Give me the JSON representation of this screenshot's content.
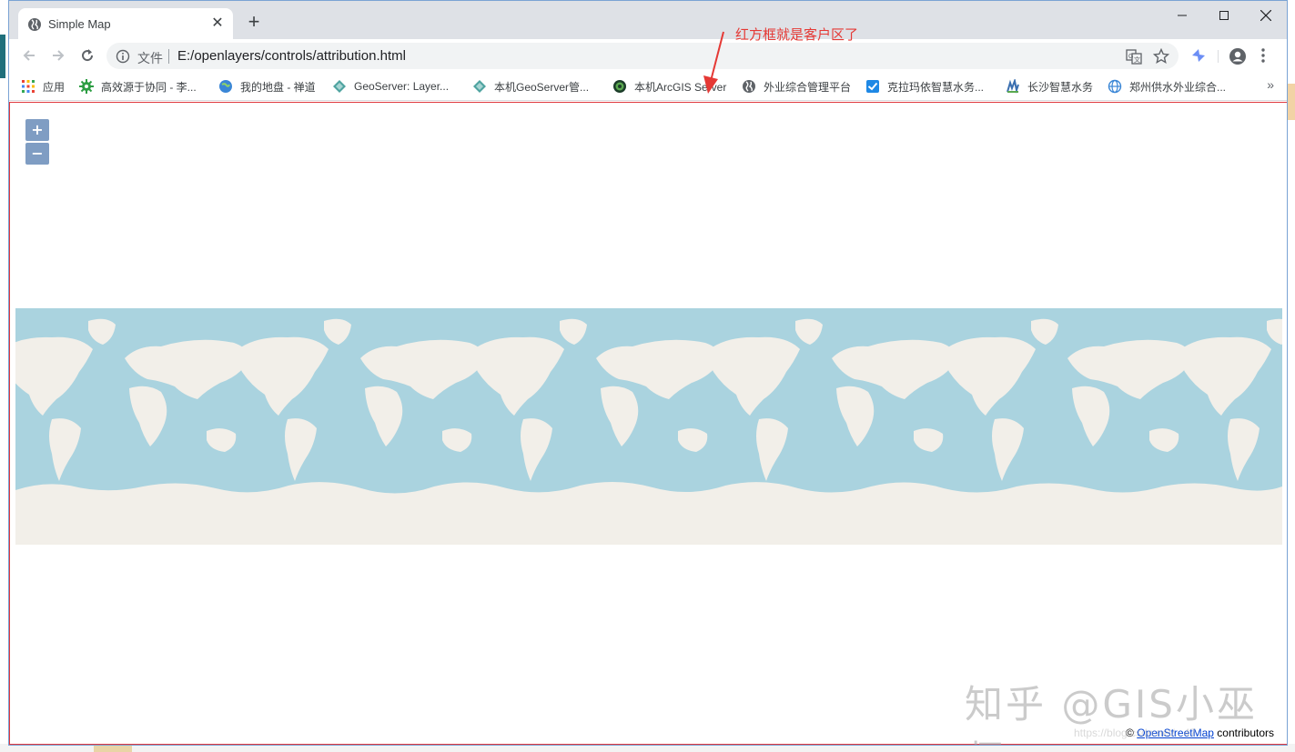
{
  "window": {
    "tab": {
      "title": "Simple Map",
      "favicon": "globe-icon",
      "close_icon": "close-icon"
    },
    "newtab_icon": "plus-icon",
    "controls": {
      "minimize": "minimize-icon",
      "maximize": "maximize-icon",
      "close": "close-icon"
    }
  },
  "toolbar": {
    "back_icon": "arrow-left-icon",
    "forward_icon": "arrow-right-icon",
    "reload_icon": "reload-icon",
    "scheme_label": "文件",
    "url": "E:/openlayers/controls/attribution.html"
  },
  "bookmarks": [
    {
      "label": "应用",
      "icon": "apps-grid-icon"
    },
    {
      "label": "高效源于协同 - 李...",
      "icon": "green-gear-icon"
    },
    {
      "label": "我的地盘 - 禅道",
      "icon": "blue-globe-icon"
    },
    {
      "label": "GeoServer: Layer...",
      "icon": "geoserver-icon"
    },
    {
      "label": "本机GeoServer管...",
      "icon": "geoserver-icon"
    },
    {
      "label": "本机ArcGIS Server",
      "icon": "arcgis-globe-icon"
    },
    {
      "label": "外业综合管理平台",
      "icon": "globe-icon"
    },
    {
      "label": "克拉玛依智慧水务...",
      "icon": "blue-check-icon"
    },
    {
      "label": "长沙智慧水务",
      "icon": "chart-icon"
    },
    {
      "label": "郑州供水外业综合...",
      "icon": "web-globe-icon"
    }
  ],
  "bookmarks_more": "»",
  "annotation": {
    "text": "红方框就是客户区了",
    "color": "#e53935"
  },
  "map": {
    "zoom_in": "+",
    "zoom_out": "−",
    "attribution_prefix": "©",
    "attribution_link": "OpenStreetMap",
    "attribution_suffix": "contributors",
    "ocean_color": "#aad3df",
    "land_color": "#f2efe9"
  },
  "watermark": "知乎 @GIS小巫师",
  "faint_url": "https://blog.csdn.net/...47"
}
